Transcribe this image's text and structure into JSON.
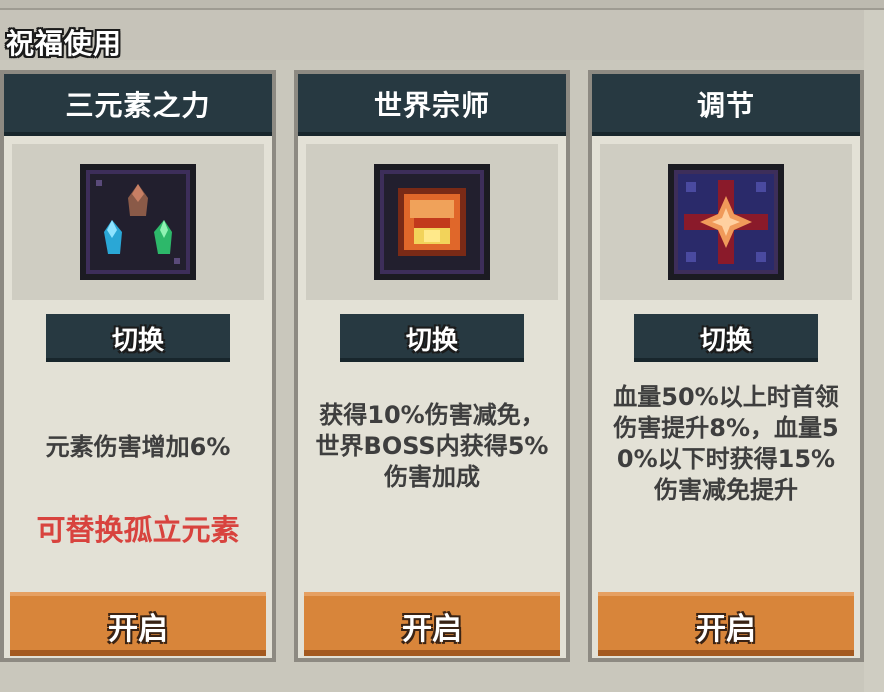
{
  "header": {
    "title": "祝福使用"
  },
  "cards": [
    {
      "title": "三元素之力",
      "icon": "tri-element-crystals-icon",
      "switch_label": "切换",
      "description_lines": [
        "元素伤害增加6%"
      ],
      "note": "可替换孤立元素",
      "open_label": "开启"
    },
    {
      "title": "世界宗师",
      "icon": "world-master-chest-icon",
      "switch_label": "切换",
      "description_lines": [
        "获得10%伤害减免，",
        "世界BOSS内获得5%",
        "伤害加成"
      ],
      "open_label": "开启"
    },
    {
      "title": "调节",
      "icon": "adjust-star-cross-icon",
      "switch_label": "切换",
      "description_lines": [
        "血量50%以上时首领",
        "伤害提升8%，血量5",
        "0%以下时获得15%",
        "伤害减免提升"
      ],
      "open_label": "开启"
    }
  ],
  "colors": {
    "card_header": "#273941",
    "open_button": "#d8853a",
    "note_text": "#d8433e"
  }
}
